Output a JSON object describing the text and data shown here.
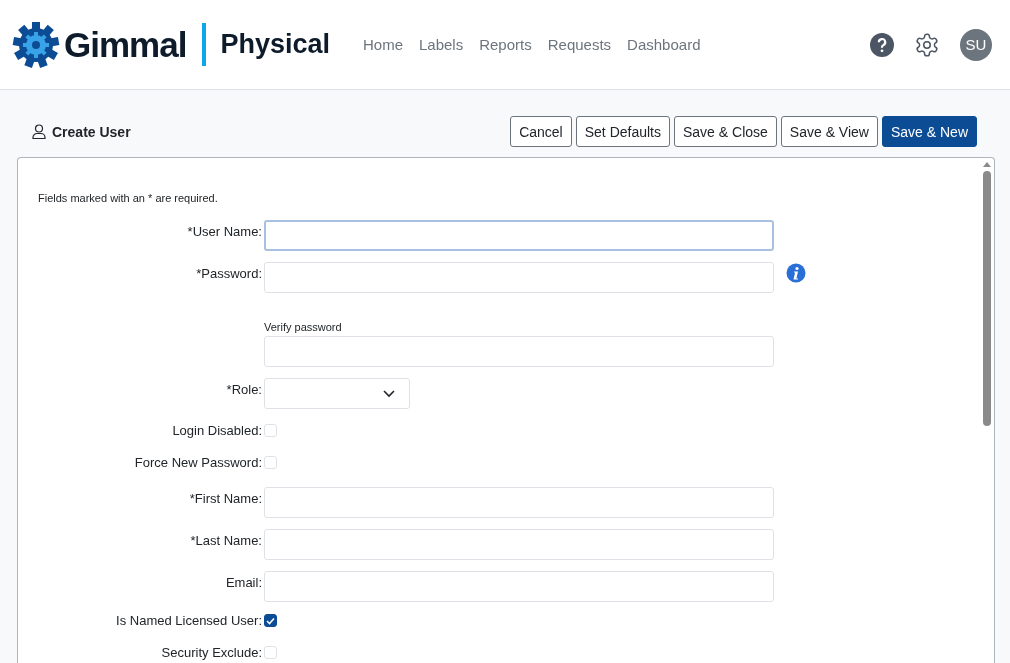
{
  "brand": {
    "name": "Gimmal",
    "product": "Physical"
  },
  "nav": [
    {
      "label": "Home"
    },
    {
      "label": "Labels"
    },
    {
      "label": "Reports"
    },
    {
      "label": "Requests"
    },
    {
      "label": "Dashboard"
    }
  ],
  "user": {
    "initials": "SU"
  },
  "page": {
    "title": "Create User"
  },
  "buttons": [
    {
      "label": "Cancel",
      "primary": false
    },
    {
      "label": "Set Defaults",
      "primary": false
    },
    {
      "label": "Save & Close",
      "primary": false
    },
    {
      "label": "Save & View",
      "primary": false
    },
    {
      "label": "Save & New",
      "primary": true
    }
  ],
  "form": {
    "note": "Fields marked with an * are required.",
    "fields": [
      {
        "kind": "text",
        "label": "*User Name:",
        "focused": true
      },
      {
        "kind": "password",
        "label": "*Password:",
        "focused": false
      },
      {
        "kind": "stacked",
        "label": "Verify password",
        "focused": false
      },
      {
        "kind": "select",
        "label": "*Role:"
      },
      {
        "kind": "checkbox",
        "label": "Login Disabled:",
        "checked": false
      },
      {
        "kind": "checkbox",
        "label": "Force New Password:",
        "checked": false
      },
      {
        "kind": "text",
        "label": "*First Name:",
        "focused": false
      },
      {
        "kind": "text",
        "label": "*Last Name:",
        "focused": false
      },
      {
        "kind": "text",
        "label": "Email:",
        "focused": false
      },
      {
        "kind": "checkbox",
        "label": "Is Named Licensed User:",
        "checked": true
      },
      {
        "kind": "checkbox",
        "label": "Security Exclude:",
        "checked": false
      }
    ]
  }
}
